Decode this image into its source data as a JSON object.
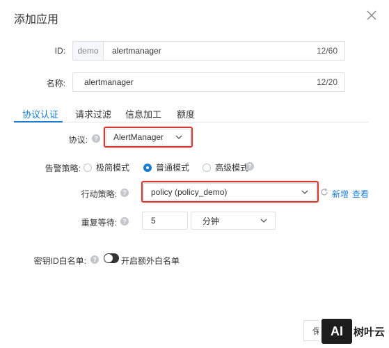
{
  "dialog": {
    "title": "添加应用"
  },
  "fields": {
    "id": {
      "label": "ID:",
      "prefix": "demo",
      "value": "alertmanager",
      "counter": "12/60"
    },
    "name": {
      "label": "名称:",
      "value": "alertmanager",
      "counter": "12/20"
    }
  },
  "tabs": [
    {
      "label": "协议认证",
      "active": true
    },
    {
      "label": "请求过滤"
    },
    {
      "label": "信息加工"
    },
    {
      "label": "额度"
    }
  ],
  "protocol": {
    "label": "协议:",
    "value": "AlertManager"
  },
  "alert_strategy": {
    "label": "告警策略:",
    "options": [
      {
        "label": "极简模式",
        "checked": false
      },
      {
        "label": "普通模式",
        "checked": true
      },
      {
        "label": "高级模式",
        "checked": false
      }
    ]
  },
  "action_policy": {
    "label": "行动策略:",
    "value": "policy (policy_demo)",
    "new_label": "新增",
    "view_label": "查看"
  },
  "repeat_wait": {
    "label": "重复等待:",
    "value": "5",
    "unit": "分钟"
  },
  "key_whitelist": {
    "label": "密钥ID白名单:",
    "toggle_label": "开启额外白名单"
  },
  "footer": {
    "save_label": "保存"
  },
  "watermark": {
    "logo": "AI",
    "text": "树叶云"
  },
  "colors": {
    "accent": "#1a7bd2",
    "highlight": "#d9352d"
  }
}
